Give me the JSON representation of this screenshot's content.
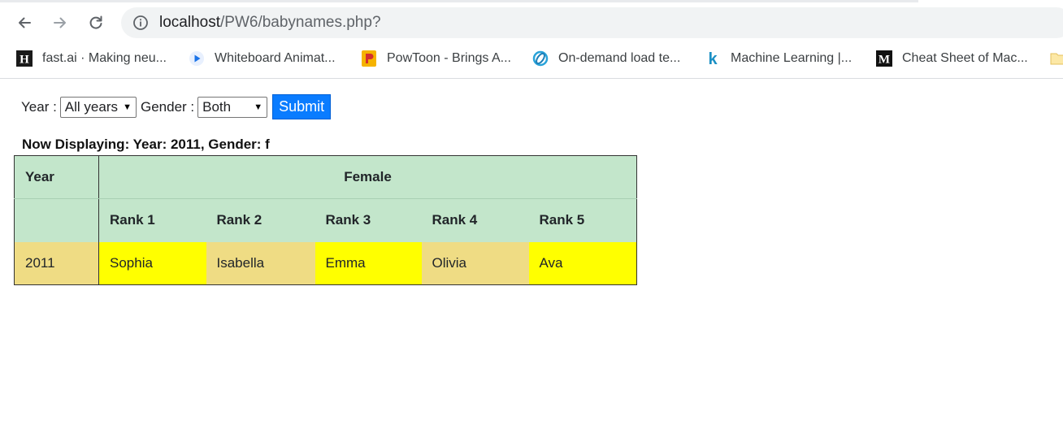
{
  "browser": {
    "url_host": "localhost",
    "url_path": "/PW6/babynames.php?",
    "bookmarks": [
      {
        "label": "fast.ai · Making neu...",
        "icon": "fastai-h-icon"
      },
      {
        "label": "Whiteboard Animat...",
        "icon": "play-circle-icon"
      },
      {
        "label": "PowToon - Brings A...",
        "icon": "powtoon-icon"
      },
      {
        "label": "On-demand load te...",
        "icon": "swirl-icon"
      },
      {
        "label": "Machine Learning |...",
        "icon": "k-icon"
      },
      {
        "label": "Cheat Sheet of Mac...",
        "icon": "medium-m-icon"
      }
    ]
  },
  "form": {
    "year_label": "Year :",
    "year_selected": "All years",
    "gender_label": "Gender :",
    "gender_selected": "Both",
    "submit_label": "Submit"
  },
  "status": {
    "now_displaying": "Now Displaying: Year: 2011, Gender: f"
  },
  "table": {
    "year_header": "Year",
    "group_header": "Female",
    "rank_headers": [
      "Rank 1",
      "Rank 2",
      "Rank 3",
      "Rank 4",
      "Rank 5"
    ],
    "rows": [
      {
        "year": "2011",
        "names": [
          "Sophia",
          "Isabella",
          "Emma",
          "Olivia",
          "Ava"
        ]
      }
    ]
  },
  "colors": {
    "header_bg": "#c3e6cb",
    "cell_tan": "#efdc84",
    "cell_yellow": "#ffff00",
    "submit_bg": "#0a7cff"
  }
}
